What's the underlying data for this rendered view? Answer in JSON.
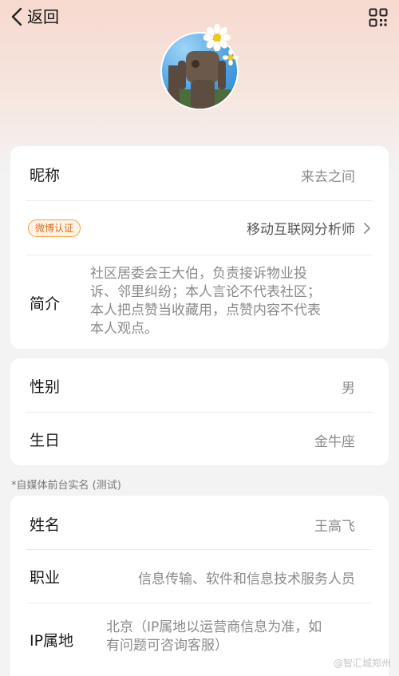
{
  "header": {
    "back_label": "返回"
  },
  "profile": {
    "card1": {
      "nickname_label": "昵称",
      "nickname_value": "来去之间",
      "verified_badge": "微博认证",
      "verified_value": "移动互联网分析师",
      "bio_label": "简介",
      "bio_lines": [
        "社区居委会王大伯，负责接诉物业投",
        "诉、邻里纠纷；本人言论不代表社区；",
        "本人把点赞当收藏用，点赞内容不代表",
        "本人观点。"
      ]
    },
    "card2": {
      "gender_label": "性别",
      "gender_value": "男",
      "birthday_label": "生日",
      "birthday_value": "金牛座"
    },
    "section_note": "*自媒体前台实名 (测试)",
    "card3": {
      "name_label": "姓名",
      "name_value": "王高飞",
      "job_label": "职业",
      "job_value": "信息传输、软件和信息技术服务人员",
      "ip_label": "IP属地",
      "ip_lines": [
        "北京（IP属地以运营商信息为准，如",
        "有问题可咨询客服）"
      ]
    }
  },
  "watermark": "@智汇城郑州"
}
